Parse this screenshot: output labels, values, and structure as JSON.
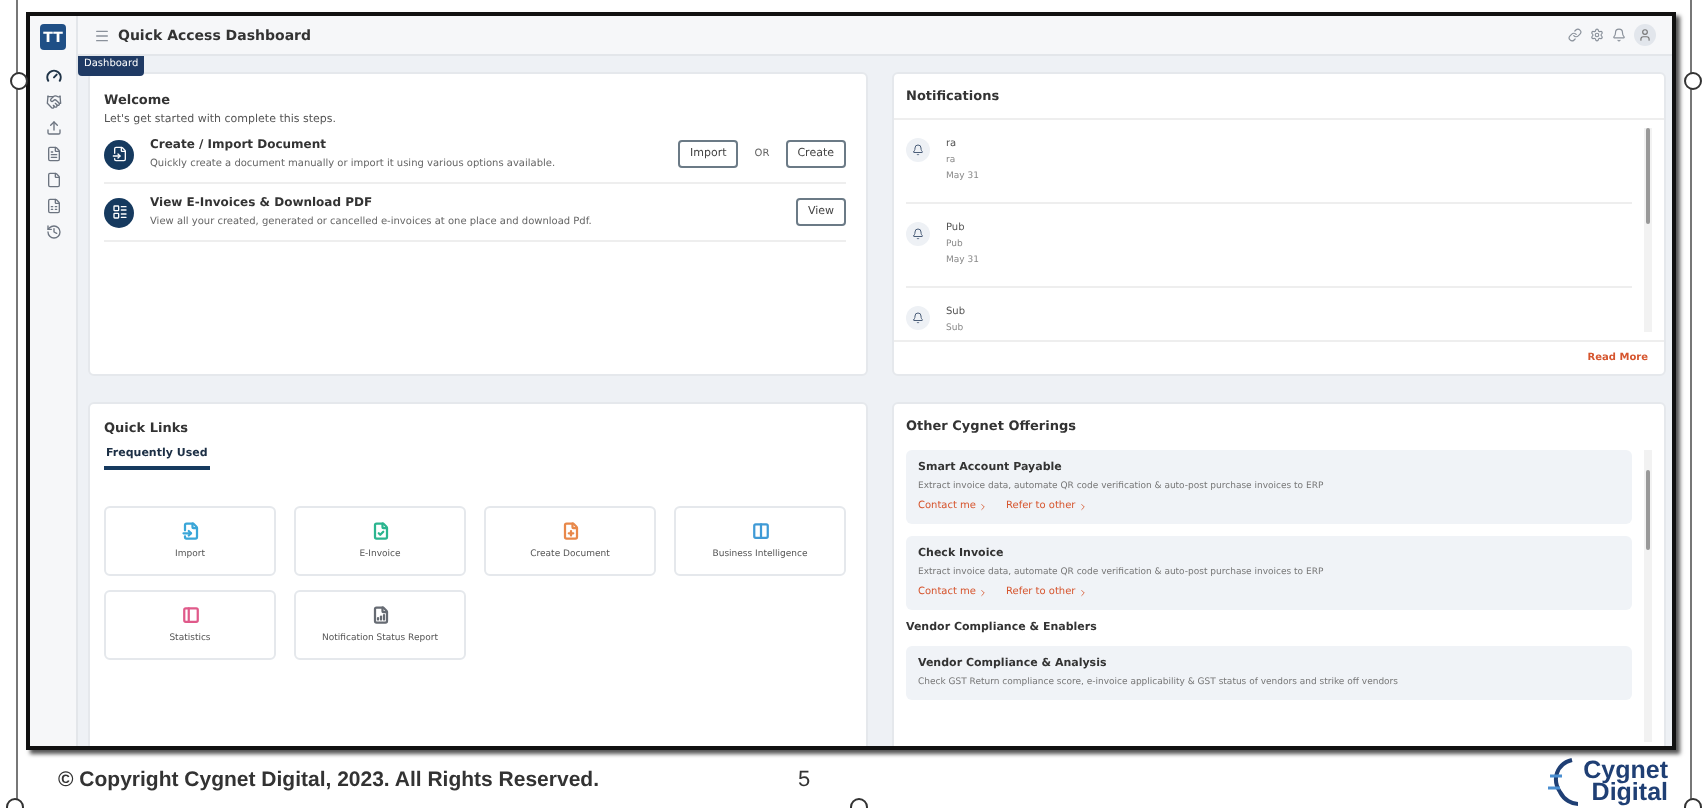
{
  "app": {
    "logo": "TT",
    "title": "Quick Access Dashboard",
    "tooltip": "Dashboard"
  },
  "sidebar": {
    "items": [
      {
        "selected": true
      },
      {
        "selected": false
      },
      {
        "selected": false
      },
      {
        "selected": false
      },
      {
        "selected": false
      },
      {
        "selected": false
      },
      {
        "selected": false
      }
    ]
  },
  "welcome": {
    "title": "Welcome",
    "subtitle": "Let's get started with complete this steps.",
    "steps": [
      {
        "title": "Create / Import Document",
        "description": "Quickly create a document manually or import it using various options available.",
        "buttons": [
          "Import",
          "Create"
        ],
        "separator": "OR"
      },
      {
        "title": "View E-Invoices & Download PDF",
        "description": "View all your created, generated or cancelled e-invoices at one place and download Pdf.",
        "buttons": [
          "View"
        ]
      }
    ]
  },
  "notifications": {
    "title": "Notifications",
    "link": "Read More",
    "items": [
      {
        "title": "ra",
        "body": "ra",
        "date": "May 31"
      },
      {
        "title": "Pub",
        "body": "Pub",
        "date": "May 31"
      },
      {
        "title": "Sub",
        "body": "Sub"
      }
    ]
  },
  "quick_links": {
    "title": "Quick Links",
    "tabs": [
      {
        "label": "Frequently Used",
        "selected": true
      }
    ],
    "tiles": [
      {
        "label": "Import",
        "color": "#3aa6d8"
      },
      {
        "label": "E-Invoice",
        "color": "#2bb58f"
      },
      {
        "label": "Create Document",
        "color": "#e8884a"
      },
      {
        "label": "Business Intelligence",
        "color": "#3f9ad6"
      },
      {
        "label": "Statistics",
        "color": "#e05a8a"
      },
      {
        "label": "Notification Status Report",
        "color": "#666b73"
      }
    ]
  },
  "offerings": {
    "title": "Other Cygnet Offerings",
    "items": [
      {
        "kind": "card",
        "title": "Smart Account Payable",
        "description": "Extract invoice data, automate QR code verification & auto-post purchase invoices to ERP",
        "links": [
          "Contact me",
          "Refer to other"
        ]
      },
      {
        "kind": "card",
        "title": "Check Invoice",
        "description": "Extract invoice data, automate QR code verification & auto-post purchase invoices to ERP",
        "links": [
          "Contact me",
          "Refer to other"
        ]
      },
      {
        "kind": "heading",
        "title": "Vendor Compliance & Enablers"
      },
      {
        "kind": "card",
        "title": "Vendor Compliance & Analysis",
        "description": "Check GST Return compliance score, e-invoice applicability & GST status of vendors and strike off vendors"
      }
    ]
  },
  "footer": {
    "copyright": "© Copyright Cygnet Digital, 2023. All Rights Reserved.",
    "page": "5",
    "logo": [
      "Cygnet",
      "Digital"
    ]
  }
}
